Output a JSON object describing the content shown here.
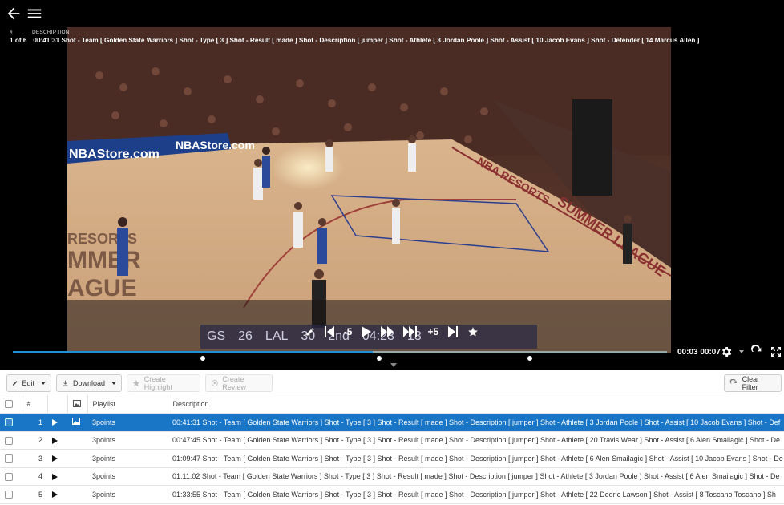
{
  "header": {
    "hash_label": "#",
    "description_label": "DESCRIPTION",
    "position": "1 of 6",
    "current_description": "00:41:31 Shot - Team [ Golden State Warriors ] Shot - Type [ 3 ] Shot - Result [ made ] Shot - Description [ jumper ] Shot - Athlete [ 3 Jordan Poole ] Shot - Assist [ 10 Jacob Evans ] Shot - Defender [ 14 Marcus Allen ]"
  },
  "player": {
    "scorebug": [
      "GS",
      "26",
      "LAL",
      "30",
      "2nd",
      "04:23",
      "13"
    ],
    "controls": {
      "rewind_label": "-5",
      "forward_label": "+5"
    },
    "timecode": "00:03 00:07",
    "progress": 0.55,
    "markers": [
      0.29,
      0.56,
      0.79
    ],
    "court_text": [
      "NBAStore.com",
      "NBAStore.com",
      "RESORTS",
      "MMER",
      "AGUE",
      "NBA RESORTS",
      "SUMMER LEAGUE"
    ]
  },
  "toolbar": {
    "edit": "Edit",
    "download": "Download",
    "create_highlight": "Create Highlight",
    "create_review": "Create Review",
    "clear_filter": "Clear Filter"
  },
  "table": {
    "headers": {
      "num": "#",
      "playlist": "Playlist",
      "description": "Description"
    },
    "rows": [
      {
        "num": "1",
        "playlist": "3points",
        "description": "00:41:31 Shot - Team [ Golden State Warriors ] Shot - Type [ 3 ] Shot - Result [ made ] Shot - Description [ jumper ] Shot - Athlete [ 3 Jordan Poole ] Shot - Assist [ 10 Jacob Evans ] Shot - Def",
        "selected": true
      },
      {
        "num": "2",
        "playlist": "3points",
        "description": "00:47:45 Shot - Team [ Golden State Warriors ] Shot - Type [ 3 ] Shot - Result [ made ] Shot - Description [ jumper ] Shot - Athlete [ 20 Travis Wear ] Shot - Assist [ 6 Alen Smailagic ] Shot - De"
      },
      {
        "num": "3",
        "playlist": "3points",
        "description": "01:09:47 Shot - Team [ Golden State Warriors ] Shot - Type [ 3 ] Shot - Result [ made ] Shot - Description [ jumper ] Shot - Athlete [ 6 Alen Smailagic ] Shot - Assist [ 10 Jacob Evans ] Shot - De"
      },
      {
        "num": "4",
        "playlist": "3points",
        "description": "01:11:02 Shot - Team [ Golden State Warriors ] Shot - Type [ 3 ] Shot - Result [ made ] Shot - Description [ jumper ] Shot - Athlete [ 3 Jordan Poole ] Shot - Assist [ 6 Alen Smailagic ] Shot - De"
      },
      {
        "num": "5",
        "playlist": "3points",
        "description": "01:33:55 Shot - Team [ Golden State Warriors ] Shot - Type [ 3 ] Shot - Result [ made ] Shot - Description [ jumper ] Shot - Athlete [ 22 Dedric Lawson ] Shot - Assist [ 8 Toscano Toscano ] Sh"
      }
    ]
  }
}
